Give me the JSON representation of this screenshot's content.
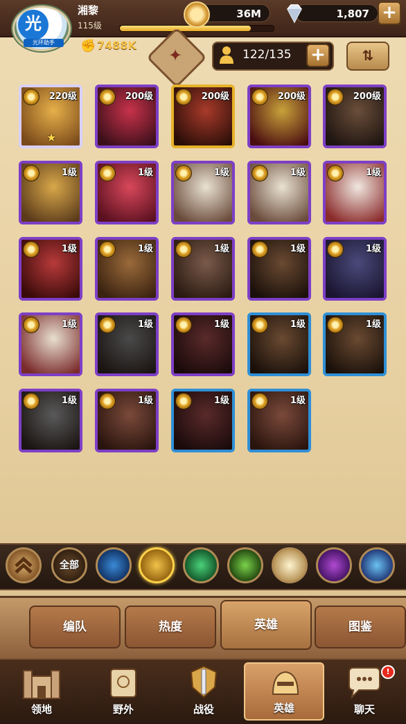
{
  "player": {
    "name": "湘黎",
    "level": "115级",
    "power": "7488K",
    "xp_fraction": 0.85
  },
  "watermark": {
    "logo": "光",
    "label": "光环助手"
  },
  "currency": {
    "gold": "36M",
    "gems": "1,807",
    "gold_icon": "gold-coin-icon",
    "gem_icon": "diamond-icon"
  },
  "roster": {
    "count": "122/135"
  },
  "heroes": [
    {
      "level": "220级",
      "tier": "white",
      "star": "★",
      "art": [
        "#e7b04a",
        "#7a4a1a"
      ]
    },
    {
      "level": "200级",
      "tier": "purple",
      "art": [
        "#c8324a",
        "#3a0f1a"
      ]
    },
    {
      "level": "200级",
      "tier": "gold",
      "art": [
        "#a83a2a",
        "#2a0e08"
      ]
    },
    {
      "level": "200级",
      "tier": "purple",
      "art": [
        "#c9a23a",
        "#4a0e10"
      ]
    },
    {
      "level": "200级",
      "tier": "purple",
      "art": [
        "#6a4e3a",
        "#1e1410"
      ]
    },
    {
      "level": "1级",
      "tier": "purple",
      "art": [
        "#d8a84a",
        "#5a3a1a"
      ]
    },
    {
      "level": "1级",
      "tier": "purple",
      "art": [
        "#d8485a",
        "#5a1020"
      ]
    },
    {
      "level": "1级",
      "tier": "purple",
      "art": [
        "#e9e2d2",
        "#6a4a3a"
      ]
    },
    {
      "level": "1级",
      "tier": "purple",
      "art": [
        "#e9e2d2",
        "#6a4a3a"
      ]
    },
    {
      "level": "1级",
      "tier": "purple",
      "art": [
        "#f0e8e0",
        "#8a2a2a"
      ]
    },
    {
      "level": "1级",
      "tier": "purple",
      "art": [
        "#b83a3a",
        "#3a0a0a"
      ]
    },
    {
      "level": "1级",
      "tier": "purple",
      "art": [
        "#9a6a3a",
        "#3a2210"
      ]
    },
    {
      "level": "1级",
      "tier": "purple",
      "art": [
        "#7a5a4a",
        "#2a1a12"
      ]
    },
    {
      "level": "1级",
      "tier": "purple",
      "art": [
        "#6a4a32",
        "#1a100a"
      ]
    },
    {
      "level": "1级",
      "tier": "purple",
      "art": [
        "#4a4a7a",
        "#1a1430"
      ]
    },
    {
      "level": "1级",
      "tier": "purple",
      "art": [
        "#e8e0d0",
        "#7a2a2a"
      ]
    },
    {
      "level": "1级",
      "tier": "purple",
      "art": [
        "#4a4a4a",
        "#1a1412"
      ]
    },
    {
      "level": "1级",
      "tier": "purple",
      "art": [
        "#5a2a2a",
        "#1a0a0a"
      ]
    },
    {
      "level": "1级",
      "tier": "blue",
      "art": [
        "#6a4a32",
        "#1a100a"
      ]
    },
    {
      "level": "1级",
      "tier": "blue",
      "art": [
        "#6a4a32",
        "#1a100a"
      ]
    },
    {
      "level": "1级",
      "tier": "purple",
      "art": [
        "#5a5a5a",
        "#1a1412"
      ]
    },
    {
      "level": "1级",
      "tier": "purple",
      "art": [
        "#7a4a3a",
        "#2a140e"
      ]
    },
    {
      "level": "1级",
      "tier": "blue",
      "art": [
        "#5a2a2a",
        "#1a0a0a"
      ]
    },
    {
      "level": "1级",
      "tier": "blue",
      "art": [
        "#7a4a3a",
        "#2a140e"
      ]
    }
  ],
  "filters": [
    {
      "name": "collapse-filter-button",
      "label": "",
      "colors": [
        "#d9b070",
        "#7a4a1e"
      ]
    },
    {
      "name": "all-filter-button",
      "label": "全部",
      "colors": [
        "#6a4a2a",
        "#2a1a0e"
      ]
    },
    {
      "name": "faction-lightbearer-button",
      "label": "",
      "colors": [
        "#3a8ad6",
        "#0e2a5a"
      ]
    },
    {
      "name": "faction-mauler-button",
      "label": "",
      "colors": [
        "#f2c24a",
        "#8a5a0a"
      ],
      "selected": true
    },
    {
      "name": "faction-wilder-button",
      "label": "",
      "colors": [
        "#4ad27a",
        "#0e4a22"
      ]
    },
    {
      "name": "faction-graveborn-button",
      "label": "",
      "colors": [
        "#7ad24a",
        "#1a3a0a"
      ]
    },
    {
      "name": "faction-celestial-button",
      "label": "",
      "colors": [
        "#fff4d0",
        "#b08a4a"
      ]
    },
    {
      "name": "faction-hypogean-button",
      "label": "",
      "colors": [
        "#b04ad2",
        "#3a0e5a"
      ]
    },
    {
      "name": "faction-dimensional-button",
      "label": "",
      "colors": [
        "#6ac2f2",
        "#1a2a6a"
      ]
    }
  ],
  "tabs": [
    "编队",
    "热度",
    "英雄",
    "图鉴"
  ],
  "nav": [
    {
      "label": "领地",
      "icon": "castle-icon"
    },
    {
      "label": "野外",
      "icon": "scroll-map-icon"
    },
    {
      "label": "战役",
      "icon": "sword-shield-icon"
    },
    {
      "label": "英雄",
      "icon": "hero-helmet-icon"
    },
    {
      "label": "聊天",
      "icon": "chat-bubble-icon"
    }
  ],
  "chat_badge": "!"
}
